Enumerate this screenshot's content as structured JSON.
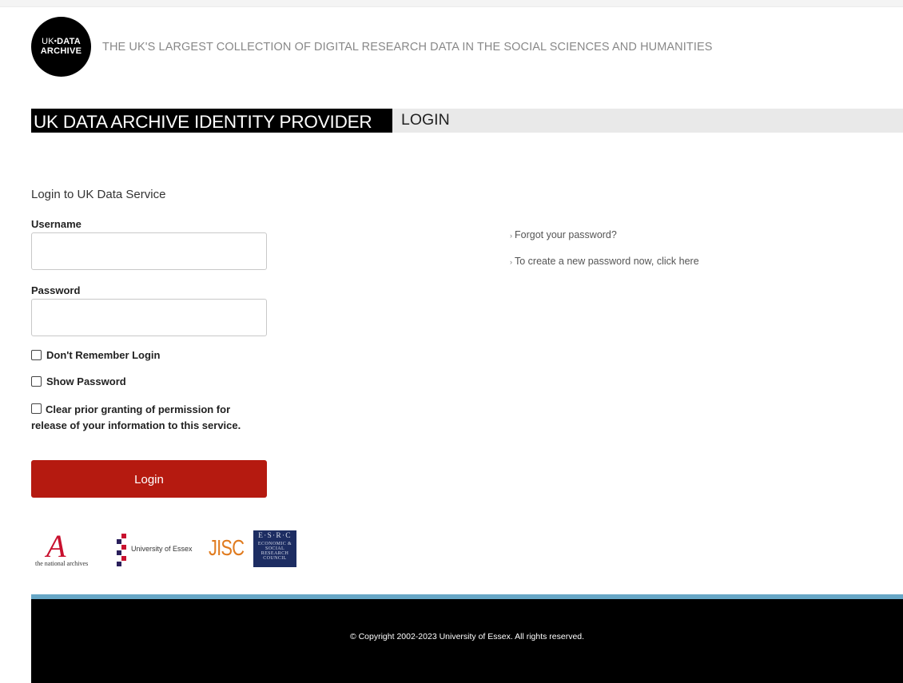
{
  "header": {
    "logo_line1_a": "UK",
    "logo_line1_b": "DATA",
    "logo_line2": "ARCHIVE",
    "tagline": "THE UK'S LARGEST COLLECTION OF DIGITAL RESEARCH DATA IN THE SOCIAL SCIENCES AND HUMANITIES"
  },
  "titlebar": {
    "title": "UK DATA ARCHIVE IDENTITY PROVIDER",
    "subtitle": "LOGIN"
  },
  "form": {
    "intro": "Login to UK Data Service",
    "username_label": "Username",
    "username_value": "",
    "password_label": "Password",
    "password_value": "",
    "dont_remember_label": "Don't Remember Login",
    "show_password_label": "Show Password",
    "clear_permission_label": "Clear prior granting of permission for release of your information to this service.",
    "login_label": "Login"
  },
  "links": {
    "forgot_password": "Forgot your password?",
    "create_password": "To create a new password now, click here"
  },
  "partners": {
    "tna_text": "the national archives",
    "essex_text": "University of Essex",
    "jisc_text": "JISC",
    "esrc_text": "E·S·R·C",
    "esrc_subtext": "ECONOMIC & SOCIAL RESEARCH COUNCIL"
  },
  "footer": {
    "copyright": "© Copyright 2002-2023 University of Essex. All rights reserved."
  },
  "colors": {
    "login_button": "#b51a10",
    "footer_stripe": "#67a7c6",
    "title_dark": "#000000",
    "title_light": "#e9e9e9"
  }
}
